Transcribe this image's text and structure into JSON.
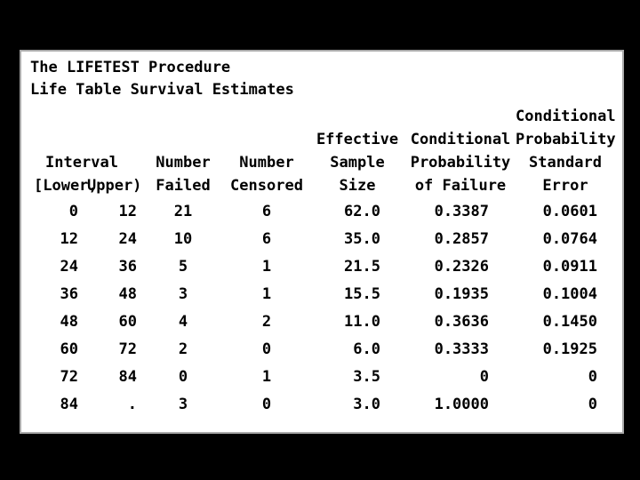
{
  "title1": "The LIFETEST Procedure",
  "title2": "Life Table Survival Estimates",
  "headers": {
    "interval": "Interval",
    "lower": "[Lower,",
    "upper": "Upper)",
    "numFailed_top": "Number",
    "numFailed_bot": "Failed",
    "numCensored_top": "Number",
    "numCensored_bot": "Censored",
    "effSample_t1": "Effective",
    "effSample_t2": "Sample",
    "effSample_t3": "Size",
    "condProb_t1": "Conditional",
    "condProb_t2": "Probability",
    "condProb_t3": "of Failure",
    "se_t1": "Conditional",
    "se_t2": "Probability",
    "se_t3": "Standard",
    "se_t4": "Error"
  },
  "rows": [
    {
      "lower": "0",
      "upper": "12",
      "failed": "21",
      "censored": "6",
      "size": "62.0",
      "prob": "0.3387",
      "se": "0.0601"
    },
    {
      "lower": "12",
      "upper": "24",
      "failed": "10",
      "censored": "6",
      "size": "35.0",
      "prob": "0.2857",
      "se": "0.0764"
    },
    {
      "lower": "24",
      "upper": "36",
      "failed": "5",
      "censored": "1",
      "size": "21.5",
      "prob": "0.2326",
      "se": "0.0911"
    },
    {
      "lower": "36",
      "upper": "48",
      "failed": "3",
      "censored": "1",
      "size": "15.5",
      "prob": "0.1935",
      "se": "0.1004"
    },
    {
      "lower": "48",
      "upper": "60",
      "failed": "4",
      "censored": "2",
      "size": "11.0",
      "prob": "0.3636",
      "se": "0.1450"
    },
    {
      "lower": "60",
      "upper": "72",
      "failed": "2",
      "censored": "0",
      "size": "6.0",
      "prob": "0.3333",
      "se": "0.1925"
    },
    {
      "lower": "72",
      "upper": "84",
      "failed": "0",
      "censored": "1",
      "size": "3.5",
      "prob": "0",
      "se": "0"
    },
    {
      "lower": "84",
      "upper": ".",
      "failed": "3",
      "censored": "0",
      "size": "3.0",
      "prob": "1.0000",
      "se": "0"
    }
  ],
  "chart_data": {
    "type": "table",
    "title": "Life Table Survival Estimates",
    "columns": [
      "[Lower",
      "Upper)",
      "Number Failed",
      "Number Censored",
      "Effective Sample Size",
      "Conditional Probability of Failure",
      "Conditional Probability Standard Error"
    ],
    "rows": [
      [
        0,
        12,
        21,
        6,
        62.0,
        0.3387,
        0.0601
      ],
      [
        12,
        24,
        10,
        6,
        35.0,
        0.2857,
        0.0764
      ],
      [
        24,
        36,
        5,
        1,
        21.5,
        0.2326,
        0.0911
      ],
      [
        36,
        48,
        3,
        1,
        15.5,
        0.1935,
        0.1004
      ],
      [
        48,
        60,
        4,
        2,
        11.0,
        0.3636,
        0.145
      ],
      [
        60,
        72,
        2,
        0,
        6.0,
        0.3333,
        0.1925
      ],
      [
        72,
        84,
        0,
        1,
        3.5,
        0,
        0
      ],
      [
        84,
        null,
        3,
        0,
        3.0,
        1.0,
        0
      ]
    ]
  }
}
